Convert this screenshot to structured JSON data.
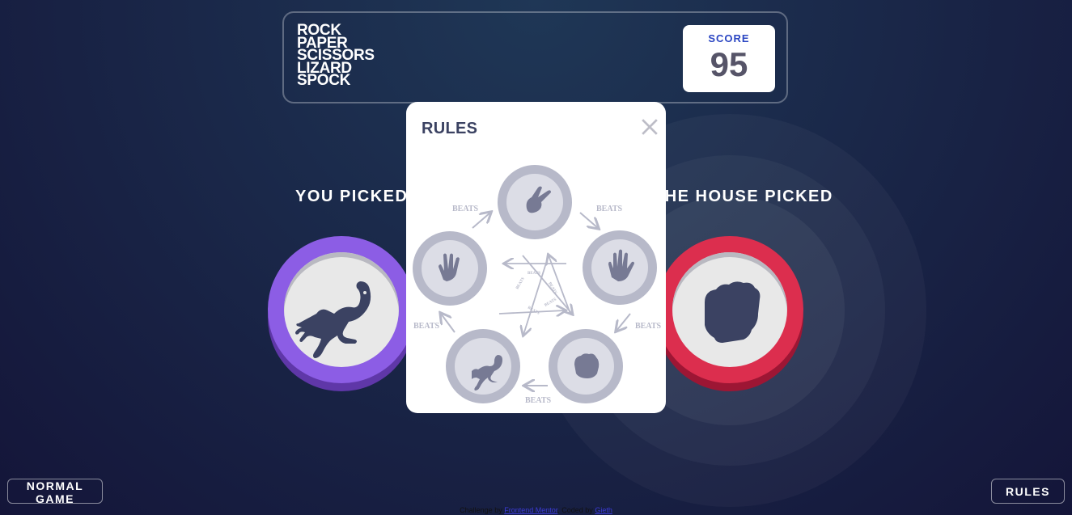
{
  "game": {
    "title_lines": [
      "ROCK",
      "PAPER",
      "SCISSORS",
      "LIZARD",
      "SPOCK"
    ],
    "score_label": "SCORE",
    "score_value": "95"
  },
  "result": {
    "you_picked_label": "YOU PICKED",
    "house_picked_label": "THE HOUSE PICKED",
    "your_pick": "lizard-icon",
    "house_pick": "rock-icon"
  },
  "controls": {
    "mode_button": "NORMAL GAME",
    "rules_button": "RULES"
  },
  "rules_modal": {
    "title": "RULES",
    "beats_label": "BEATS",
    "diagram_icons": [
      "scissors-icon",
      "paper-icon",
      "rock-icon",
      "lizard-icon",
      "spock-icon"
    ]
  },
  "footer": {
    "challenge_prefix": "Challenge by",
    "challenge_link": "Frontend Mentor",
    "coded_prefix": ". Coded by",
    "coded_link": "Gieth"
  },
  "colors": {
    "lizard": "#8c5de5",
    "rock": "#dc2e4e",
    "score_label": "#2a45c2",
    "dark_text": "#3b4262"
  }
}
